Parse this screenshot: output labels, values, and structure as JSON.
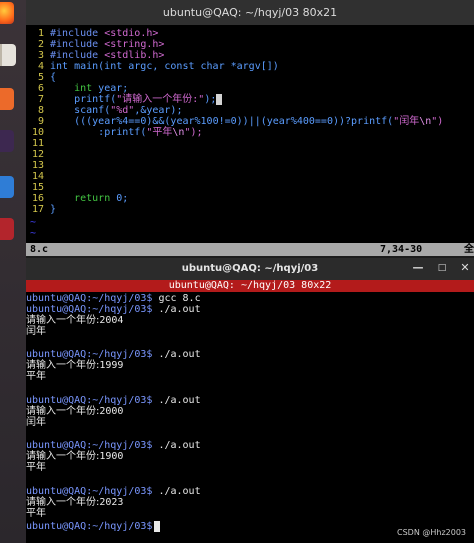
{
  "vim_window": {
    "title": "ubuntu@QAQ: ~/hqyj/03 80x21",
    "status_file": "8.c",
    "status_pos": "7,34-30",
    "status_scroll": "全"
  },
  "code": {
    "n1": "1",
    "l1_pp": "#include",
    "l1_str": "<stdio.h>",
    "n2": "2",
    "l2_pp": "#include",
    "l2_str": "<string.h>",
    "n3": "3",
    "l3_pp": "#include",
    "l3_str": "<stdlib.h>",
    "n4": "4",
    "l4": "int main(int argc, const char *argv[])",
    "n5": "5",
    "l5": "{",
    "n6": "6",
    "l6_kw": "int",
    "l6_rest": " year;",
    "n7": "7",
    "l7_a": "printf(",
    "l7_str": "\"请输入一个年份:\"",
    "n8": "8",
    "l8_a": "scanf(",
    "l8_str": "\"%d\"",
    "l8_b": ",&year);",
    "n9": "9",
    "l9_a": "(((year%4==0)&&(year%100!=0))||(year%400==0))?printf(",
    "l9_str": "\"闰年",
    "l9_esc": "\\n",
    "l9_end": "\")",
    "n10": "10",
    "l10_a": ":printf(",
    "l10_str": "\"平年",
    "l10_esc": "\\n",
    "l10_end": "\");",
    "n11": "11",
    "n12": "12",
    "n13": "13",
    "n14": "14",
    "n15": "15",
    "n16": "16",
    "l16_kw": "return",
    "l16_rest": " 0;",
    "n17": "17",
    "l17": "}",
    "tilde": "~"
  },
  "terminal": {
    "title": "ubuntu@QAQ: ~/hqyj/03",
    "size_bar": "ubuntu@QAQ: ~/hqyj/03 80x22",
    "prompt": "ubuntu@QAQ:~/hqyj/03$",
    "cmd_compile": " gcc 8.c",
    "cmd_run": " ./a.out",
    "ask": "请输入一个年份:",
    "y1": "2004",
    "r1": "闰年",
    "y2": "1999",
    "r2": "平年",
    "y3": "2000",
    "r3": "闰年",
    "y4": "1900",
    "r4": "平年",
    "y5": "2023",
    "r5": "平年"
  },
  "watermark": "CSDN @Hhz2003"
}
